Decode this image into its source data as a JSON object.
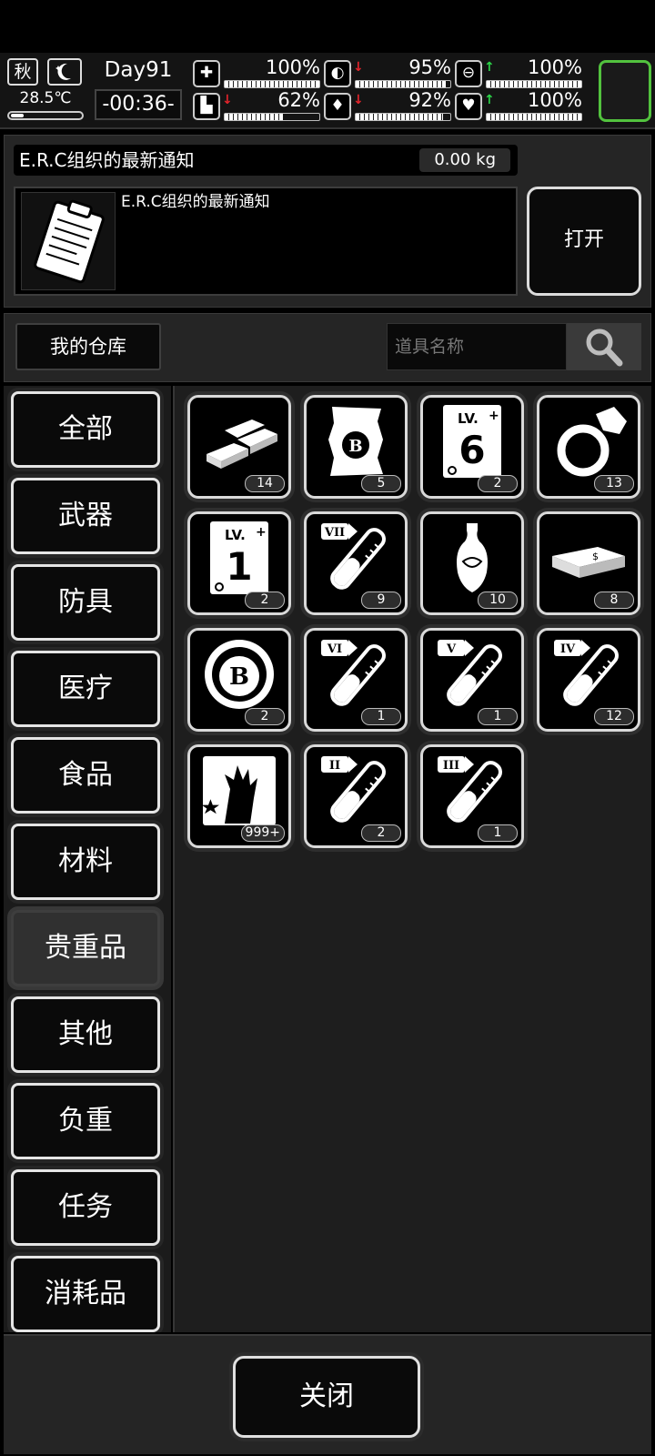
{
  "status": {
    "season": "秋",
    "temperature": "28.5℃",
    "day": "Day91",
    "clock": "-00:36-",
    "stats": [
      {
        "icon": "medkit-icon",
        "value": "100%",
        "arrow": "",
        "level": 1.0
      },
      {
        "icon": "stomach-icon",
        "value": "95%",
        "arrow": "down",
        "level": 0.95
      },
      {
        "icon": "pill-icon",
        "value": "100%",
        "arrow": "up",
        "level": 1.0
      },
      {
        "icon": "boot-icon",
        "value": "62%",
        "arrow": "down",
        "level": 0.62
      },
      {
        "icon": "water-drop-icon",
        "value": "92%",
        "arrow": "down",
        "level": 0.92
      },
      {
        "icon": "heart-icon",
        "value": "100%",
        "arrow": "up",
        "level": 1.0
      }
    ]
  },
  "notification": {
    "title": "E.R.C组织的最新通知",
    "weight": "0.00 kg",
    "body_text": "E.R.C组织的最新通知",
    "open_label": "打开"
  },
  "warehouse": {
    "title": "我的仓库",
    "search_placeholder": "道具名称"
  },
  "categories": [
    {
      "label": "全部",
      "active": false
    },
    {
      "label": "武器",
      "active": false
    },
    {
      "label": "防具",
      "active": false
    },
    {
      "label": "医疗",
      "active": false
    },
    {
      "label": "食品",
      "active": false
    },
    {
      "label": "材料",
      "active": false
    },
    {
      "label": "贵重品",
      "active": true
    },
    {
      "label": "其他",
      "active": false
    },
    {
      "label": "负重",
      "active": false
    },
    {
      "label": "任务",
      "active": false
    },
    {
      "label": "消耗品",
      "active": false
    }
  ],
  "items": [
    {
      "icon": "gold-bars-icon",
      "count": "14"
    },
    {
      "icon": "b-scroll-icon",
      "count": "5"
    },
    {
      "icon": "lv6-ticket-icon",
      "count": "2"
    },
    {
      "icon": "diamond-ring-icon",
      "count": "13"
    },
    {
      "icon": "lv1-ticket-icon",
      "count": "2"
    },
    {
      "icon": "test-tube-vii-icon",
      "count": "9"
    },
    {
      "icon": "vase-icon",
      "count": "10"
    },
    {
      "icon": "cash-stack-icon",
      "count": "8"
    },
    {
      "icon": "b-coin-icon",
      "count": "2"
    },
    {
      "icon": "test-tube-vi-icon",
      "count": "1"
    },
    {
      "icon": "test-tube-v-icon",
      "count": "1"
    },
    {
      "icon": "test-tube-iv-icon",
      "count": "12"
    },
    {
      "icon": "zombie-hand-card-icon",
      "count": "999+"
    },
    {
      "icon": "test-tube-ii-icon",
      "count": "2"
    },
    {
      "icon": "test-tube-iii-icon",
      "count": "1"
    }
  ],
  "tube_labels": {
    "5": "VII",
    "9": "VI",
    "10": "V",
    "11": "IV",
    "13": "II",
    "14": "III"
  },
  "ticket_levels": {
    "2": "6",
    "4": "1"
  },
  "footer": {
    "close_label": "关闭"
  }
}
